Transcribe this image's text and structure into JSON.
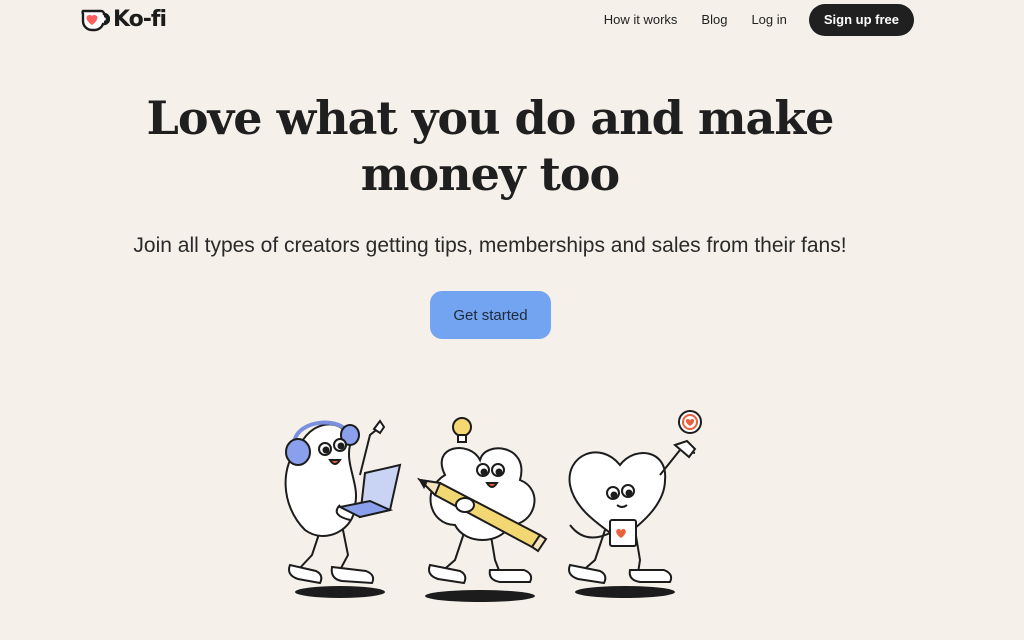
{
  "brand": {
    "name": "Ko-fi",
    "accent": "#ff5e5b"
  },
  "nav": {
    "links": [
      {
        "label": "How it works"
      },
      {
        "label": "Blog"
      },
      {
        "label": "Log in"
      }
    ],
    "signup_label": "Sign up free"
  },
  "hero": {
    "title_line1": "Love what you do and make",
    "title_line2": "money too",
    "subtitle": "Join all types of creators getting tips, memberships and sales from their fans!",
    "cta_label": "Get started",
    "cta_color": "#72a4f2"
  },
  "illustration": {
    "description_icons": [
      "headphones-character-icon",
      "pencil-character-icon",
      "heart-mug-character-icon"
    ]
  }
}
